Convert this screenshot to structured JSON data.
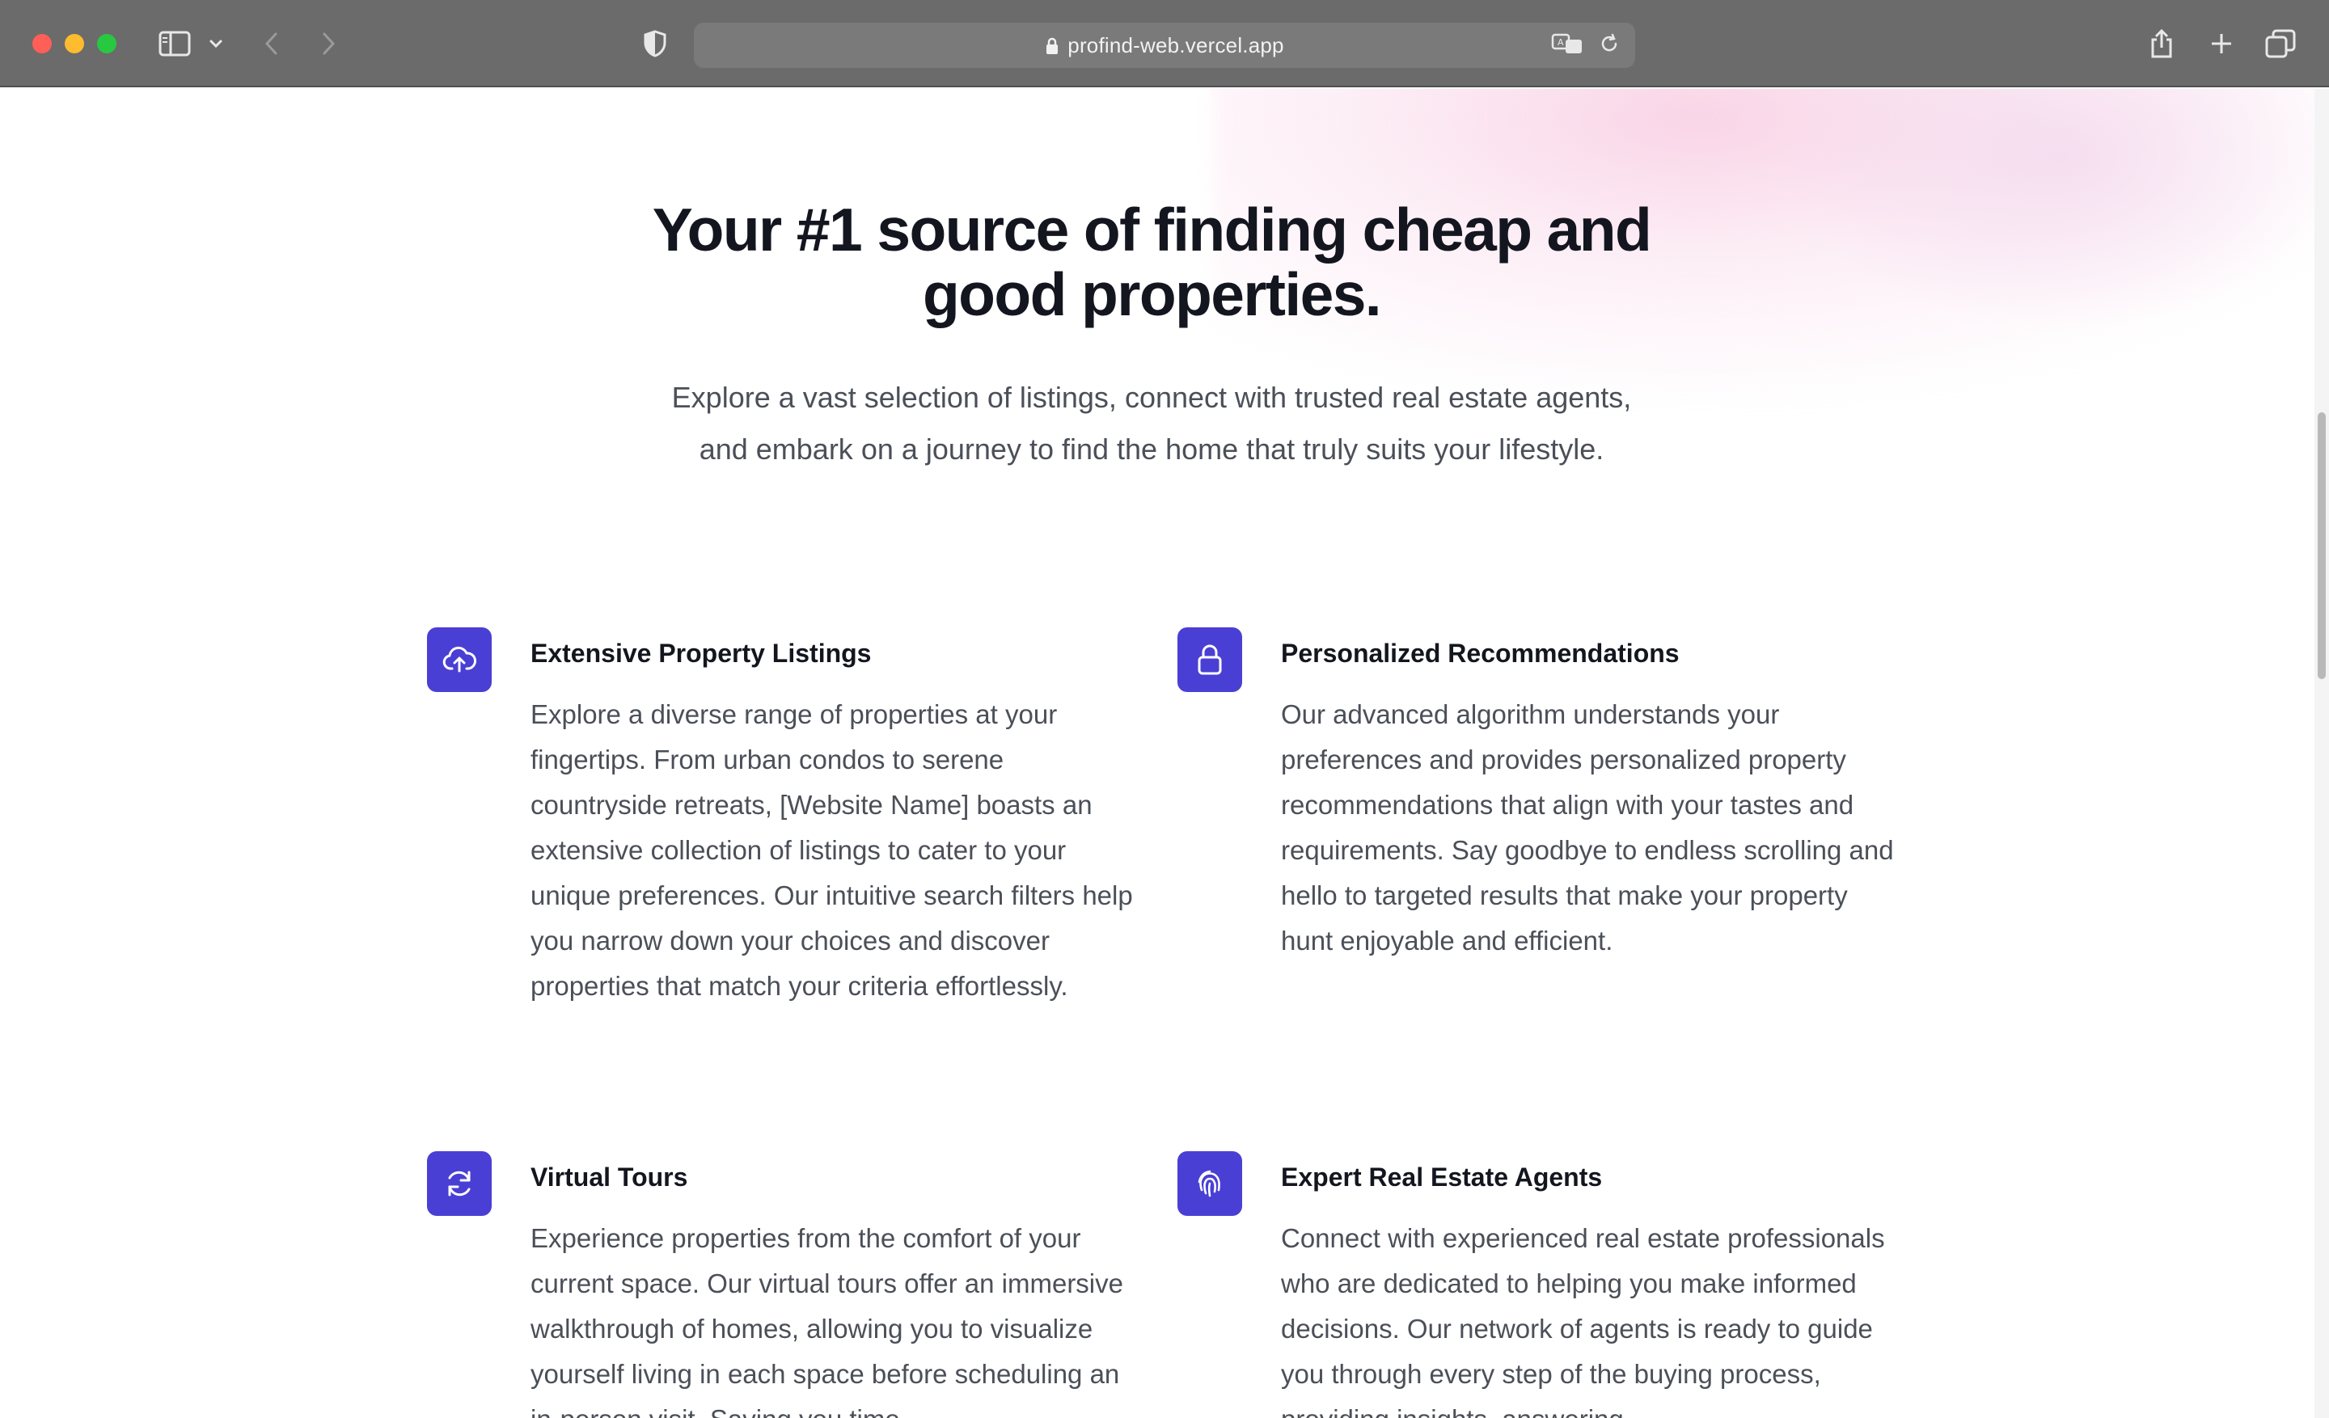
{
  "browser": {
    "url": "profind-web.vercel.app",
    "icons": [
      "sidebar-icon",
      "chevron-down-icon",
      "back-icon",
      "forward-icon",
      "shield-icon",
      "translate-icon",
      "reload-icon",
      "share-icon",
      "new-tab-icon",
      "tabs-overview-icon"
    ]
  },
  "hero": {
    "title_line1": "Your #1 source of finding cheap and",
    "title_line2": "good properties.",
    "subtitle_line1": "Explore a vast selection of listings, connect with trusted real estate agents,",
    "subtitle_line2": "and embark on a journey to find the home that truly suits your lifestyle."
  },
  "features": [
    {
      "icon": "cloud-upload-icon",
      "title": "Extensive Property Listings",
      "body": "Explore a diverse range of properties at your fingertips. From urban condos to serene countryside retreats, [Website Name] boasts an extensive collection of listings to cater to your unique preferences. Our intuitive search filters help you narrow down your choices and discover properties that match your criteria effortlessly."
    },
    {
      "icon": "lock-icon",
      "title": "Personalized Recommendations",
      "body": "Our advanced algorithm understands your preferences and provides personalized property recommendations that align with your tastes and requirements. Say goodbye to endless scrolling and hello to targeted results that make your property hunt enjoyable and efficient."
    },
    {
      "icon": "refresh-icon",
      "title": "Virtual Tours",
      "body": "Experience properties from the comfort of your current space. Our virtual tours offer an immersive walkthrough of homes, allowing you to visualize yourself living in each space before scheduling an in-person visit. Saving you time"
    },
    {
      "icon": "fingerprint-icon",
      "title": "Expert Real Estate Agents",
      "body": "Connect with experienced real estate professionals who are dedicated to helping you make informed decisions. Our network of agents is ready to guide you through every step of the buying process, providing insights, answering"
    }
  ],
  "colors": {
    "accent": "#4a3fd4",
    "heading": "#14161f",
    "body_text": "#4b4f58",
    "toolbar": "#6b6b6b"
  }
}
